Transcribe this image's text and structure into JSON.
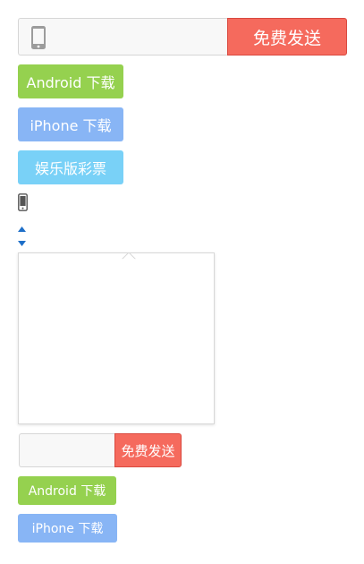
{
  "form": {
    "phone_value": "",
    "phone_icon": "mobile-phone-icon",
    "send_label": "免费发送"
  },
  "downloads": {
    "android_label": "Android 下载",
    "iphone_label": "iPhone 下载",
    "lottery_label": "娱乐版彩票"
  },
  "misc": {
    "small_phone_icon": "mobile-phone-icon",
    "arrow_up_icon": "caret-up-icon",
    "arrow_down_icon": "caret-down-icon"
  },
  "small_form": {
    "phone_value": "",
    "send_label": "免费发送"
  },
  "small_downloads": {
    "android_label": "Android 下载",
    "iphone_label": "iPhone 下载"
  },
  "colors": {
    "send_red": "#f56a5d",
    "android_green": "#95d14f",
    "iphone_blue": "#88b5f5",
    "lottery_cyan": "#79d1f7",
    "arrow_blue": "#1e6fc8"
  }
}
